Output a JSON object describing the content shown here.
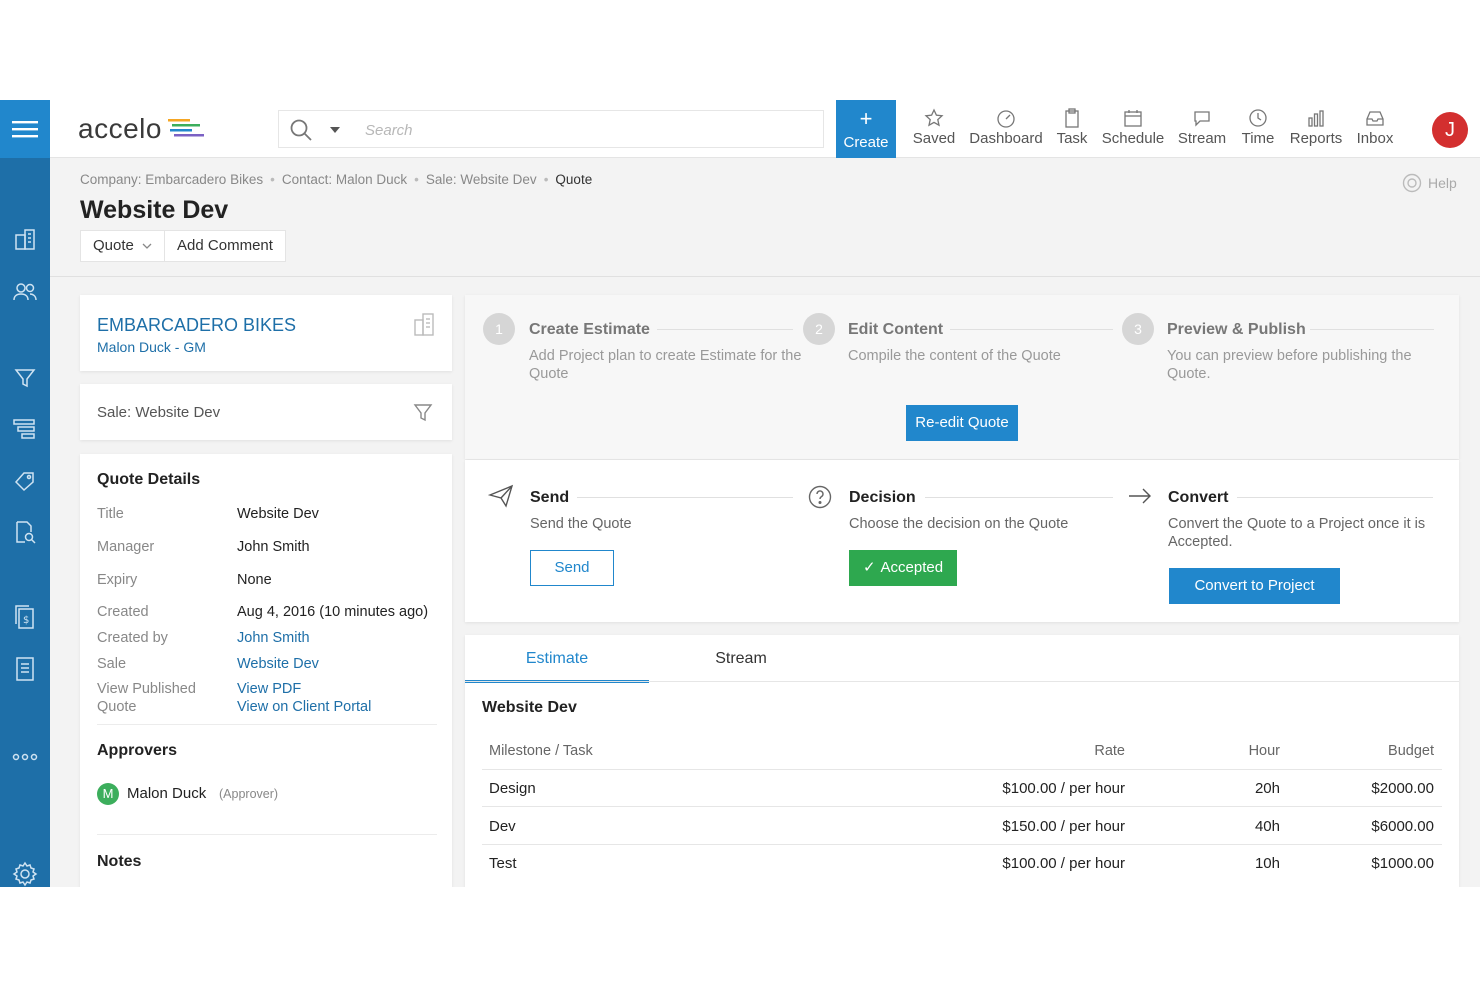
{
  "topbar": {
    "logo": "accelo",
    "search_placeholder": "Search",
    "create_label": "Create",
    "nav": [
      "Saved",
      "Dashboard",
      "Task",
      "Schedule",
      "Stream",
      "Time",
      "Reports",
      "Inbox"
    ],
    "avatar_initial": "J"
  },
  "breadcrumb": [
    "Company: Embarcadero Bikes",
    "Contact: Malon Duck",
    "Sale: Website Dev",
    "Quote"
  ],
  "help_label": "Help",
  "page_title": "Website Dev",
  "header_buttons": {
    "quote": "Quote",
    "add_comment": "Add Comment"
  },
  "company_card": {
    "name": "EMBARCADERO BIKES",
    "contact": "Malon Duck - GM"
  },
  "sale_card": {
    "label": "Sale: Website Dev"
  },
  "quote_details": {
    "title": "Quote Details",
    "rows": [
      {
        "label": "Title",
        "value": "Website Dev"
      },
      {
        "label": "Manager",
        "value": "John Smith"
      },
      {
        "label": "Expiry",
        "value": "None"
      },
      {
        "label": "Created",
        "value": "Aug 4, 2016 (10 minutes ago)"
      },
      {
        "label": "Created by",
        "value": "John Smith"
      },
      {
        "label": "Sale",
        "value": "Website Dev"
      },
      {
        "label": "View Published Quote",
        "value": "View PDF",
        "value2": "View on Client Portal"
      }
    ]
  },
  "approvers": {
    "title": "Approvers",
    "initial": "M",
    "name": "Malon Duck",
    "role": "(Approver)"
  },
  "notes_title": "Notes",
  "steps": [
    {
      "num": "1",
      "title": "Create Estimate",
      "desc": "Add Project plan to create Estimate for the Quote"
    },
    {
      "num": "2",
      "title": "Edit Content",
      "desc": "Compile the content of the Quote",
      "button": "Re-edit Quote"
    },
    {
      "num": "3",
      "title": "Preview & Publish",
      "desc": "You can preview before publishing the Quote."
    }
  ],
  "actions": [
    {
      "title": "Send",
      "desc": "Send the Quote",
      "button": "Send"
    },
    {
      "title": "Decision",
      "desc": "Choose the decision on the Quote",
      "button": "Accepted"
    },
    {
      "title": "Convert",
      "desc": "Convert the Quote to a Project once it is Accepted.",
      "button": "Convert to Project"
    }
  ],
  "tabs": [
    "Estimate",
    "Stream"
  ],
  "estimate": {
    "title": "Website Dev",
    "columns": [
      "Milestone / Task",
      "Rate",
      "Hour",
      "Budget"
    ],
    "rows": [
      {
        "task": "Design",
        "rate": "$100.00 / per hour",
        "hour": "20h",
        "budget": "$2000.00"
      },
      {
        "task": "Dev",
        "rate": "$150.00 / per hour",
        "hour": "40h",
        "budget": "$6000.00"
      },
      {
        "task": "Test",
        "rate": "$100.00 / per hour",
        "hour": "10h",
        "budget": "$1000.00"
      }
    ]
  }
}
